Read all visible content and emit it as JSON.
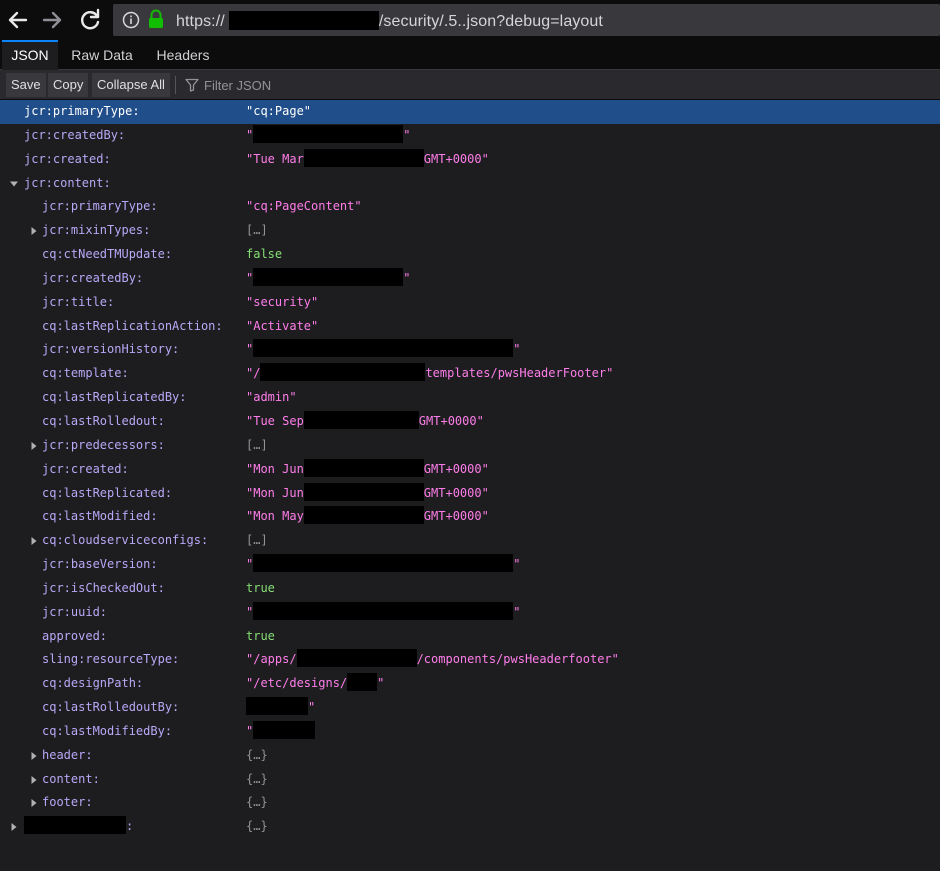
{
  "urlbar": {
    "url_prefix": "https://",
    "url_suffix": "/security/.5..json?debug=layout",
    "icons": [
      "arrow-left-icon",
      "arrow-right-icon",
      "reload-icon",
      "info-icon",
      "lock-icon"
    ],
    "lock_color": "#12bc00"
  },
  "tabs": [
    {
      "label": "JSON",
      "active": true
    },
    {
      "label": "Raw Data",
      "active": false
    },
    {
      "label": "Headers",
      "active": false
    }
  ],
  "toolbar": {
    "save": "Save",
    "copy": "Copy",
    "collapse_all": "Collapse All",
    "filter_placeholder": "Filter JSON"
  },
  "tree": [
    {
      "key": "jcr:primaryType:",
      "value": "\"cq:Page\"",
      "type": "str",
      "level": 0,
      "twisty": "none",
      "selected": true
    },
    {
      "key": "jcr:createdBy:",
      "value_pre": "\"",
      "value_post": "\"",
      "type": "str",
      "level": 0,
      "twisty": "none",
      "redacted": true
    },
    {
      "key": "jcr:created:",
      "value_pre": "\"Tue Mar",
      "value_post": "GMT+0000\"",
      "type": "str",
      "level": 0,
      "twisty": "none",
      "redacted": true
    },
    {
      "key": "jcr:content:",
      "value": "",
      "type": "none",
      "level": 0,
      "twisty": "open"
    },
    {
      "key": "jcr:primaryType:",
      "value": "\"cq:PageContent\"",
      "type": "str",
      "level": 1,
      "twisty": "none"
    },
    {
      "key": "jcr:mixinTypes:",
      "value": "[…]",
      "type": "coll",
      "level": 1,
      "twisty": "closed"
    },
    {
      "key": "cq:ctNeedTMUpdate:",
      "value": "false",
      "type": "bool",
      "level": 1,
      "twisty": "none"
    },
    {
      "key": "jcr:createdBy:",
      "value_pre": "\"",
      "value_post": "\"",
      "type": "str",
      "level": 1,
      "twisty": "none",
      "redacted": true
    },
    {
      "key": "jcr:title:",
      "value": "\"security\"",
      "type": "str",
      "level": 1,
      "twisty": "none"
    },
    {
      "key": "cq:lastReplicationAction:",
      "value": "\"Activate\"",
      "type": "str",
      "level": 1,
      "twisty": "none"
    },
    {
      "key": "jcr:versionHistory:",
      "value_pre": "\"",
      "value_post": "\"",
      "type": "str",
      "level": 1,
      "twisty": "none",
      "redacted": true
    },
    {
      "key": "cq:template:",
      "value_pre": "\"/",
      "value_post": "templates/pwsHeaderFooter\"",
      "type": "str",
      "level": 1,
      "twisty": "none",
      "redacted": true
    },
    {
      "key": "cq:lastReplicatedBy:",
      "value": "\"admin\"",
      "type": "str",
      "level": 1,
      "twisty": "none"
    },
    {
      "key": "cq:lastRolledout:",
      "value_pre": "\"Tue Sep",
      "value_post": "GMT+0000\"",
      "type": "str",
      "level": 1,
      "twisty": "none",
      "redacted": true
    },
    {
      "key": "jcr:predecessors:",
      "value": "[…]",
      "type": "coll",
      "level": 1,
      "twisty": "closed"
    },
    {
      "key": "jcr:created:",
      "value_pre": "\"Mon Jun",
      "value_post": "GMT+0000\"",
      "type": "str",
      "level": 1,
      "twisty": "none",
      "redacted": true
    },
    {
      "key": "cq:lastReplicated:",
      "value_pre": "\"Mon Jun",
      "value_post": "GMT+0000\"",
      "type": "str",
      "level": 1,
      "twisty": "none",
      "redacted": true
    },
    {
      "key": "cq:lastModified:",
      "value_pre": "\"Mon May",
      "value_post": "GMT+0000\"",
      "type": "str",
      "level": 1,
      "twisty": "none",
      "redacted": true
    },
    {
      "key": "cq:cloudserviceconfigs:",
      "value": "[…]",
      "type": "coll",
      "level": 1,
      "twisty": "closed"
    },
    {
      "key": "jcr:baseVersion:",
      "value_pre": "\"",
      "value_post": "\"",
      "type": "str",
      "level": 1,
      "twisty": "none",
      "redacted": true
    },
    {
      "key": "jcr:isCheckedOut:",
      "value": "true",
      "type": "bool",
      "level": 1,
      "twisty": "none"
    },
    {
      "key": "jcr:uuid:",
      "value_pre": "\"",
      "value_post": "\"",
      "type": "str",
      "level": 1,
      "twisty": "none",
      "redacted": true
    },
    {
      "key": "approved:",
      "value": "true",
      "type": "bool",
      "level": 1,
      "twisty": "none"
    },
    {
      "key": "sling:resourceType:",
      "value_pre": "\"/apps/",
      "value_post": "/components/pwsHeaderfooter\"",
      "type": "str",
      "level": 1,
      "twisty": "none",
      "redacted": true
    },
    {
      "key": "cq:designPath:",
      "value_pre": "\"/etc/designs/",
      "value_post": "\"",
      "type": "str",
      "level": 1,
      "twisty": "none",
      "redacted": true
    },
    {
      "key": "cq:lastRolledoutBy:",
      "value_pre": "",
      "value_post": "\"",
      "type": "str",
      "level": 1,
      "twisty": "none",
      "redacted": true
    },
    {
      "key": "cq:lastModifiedBy:",
      "value_pre": "\"",
      "value_post": "",
      "type": "str",
      "level": 1,
      "twisty": "none",
      "redacted": true
    },
    {
      "key": "header:",
      "value": "{…}",
      "type": "coll",
      "level": 1,
      "twisty": "closed"
    },
    {
      "key": "content:",
      "value": "{…}",
      "type": "coll",
      "level": 1,
      "twisty": "closed"
    },
    {
      "key": "footer:",
      "value": "{…}",
      "type": "coll",
      "level": 1,
      "twisty": "closed"
    },
    {
      "key": ":",
      "value": "{…}",
      "type": "coll",
      "level": 0,
      "twisty": "closed",
      "key_redacted": true
    }
  ]
}
